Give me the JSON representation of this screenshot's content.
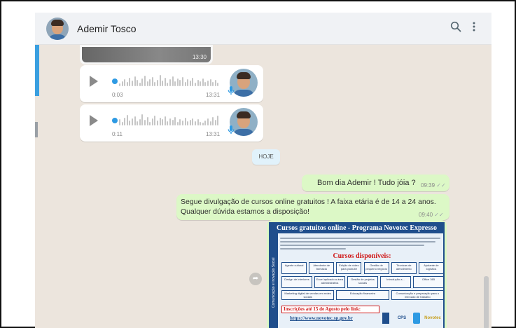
{
  "header": {
    "contact_name": "Ademir Tosco",
    "search_icon": "search-icon",
    "menu_icon": "more-vertical-icon"
  },
  "video_message": {
    "time": "13:30"
  },
  "audio_messages": [
    {
      "duration": "0:03",
      "time": "13:31"
    },
    {
      "duration": "0:11",
      "time": "13:31"
    }
  ],
  "date_divider": "HOJE",
  "outgoing": [
    {
      "text": "Bom dia Ademir ! Tudo jóia ?",
      "time": "09:39"
    },
    {
      "line1": "Segue divulgação de cursos online gratuitos ! A faixa etária é de 14 a 24 anos.",
      "line2": "Qualquer dúvida estamos a disposição!",
      "time": "09:40"
    }
  ],
  "poster": {
    "title": "Cursos gratuitos online - Programa Novotec Expresso",
    "side_text": "Comunicação e Inovação Social",
    "courses_heading": "Cursos disponíveis:",
    "courses": [
      [
        "Agente cultural",
        "Atendente de farmácia",
        "Edição de vídeo para youtube",
        "Gestão de pequeno negócio",
        "Técnicas de atendimento",
        "Ajudante de logística"
      ],
      [
        "Design de interiores",
        "Excel aplicado a área administrativa",
        "Gestão de projetos sociais",
        "Introdução a...",
        "Office 365"
      ],
      [
        "Marketing digital de vendas em redes sociais",
        "Educação financeira",
        "Comunicação e preparação para o mercado de trabalho"
      ]
    ],
    "deadline": "Inscrições até 15 de Agosto pelo link:",
    "url": "https://www.novotec.sp.gov.br",
    "logos": [
      "CPS",
      "Novotec"
    ]
  },
  "colors": {
    "outgoing_bubble": "#dcf8c6",
    "chat_background": "#ece5dd",
    "accent_blue": "#2e9ae3",
    "poster_blue": "#1f4e8c",
    "poster_red": "#d01818"
  }
}
